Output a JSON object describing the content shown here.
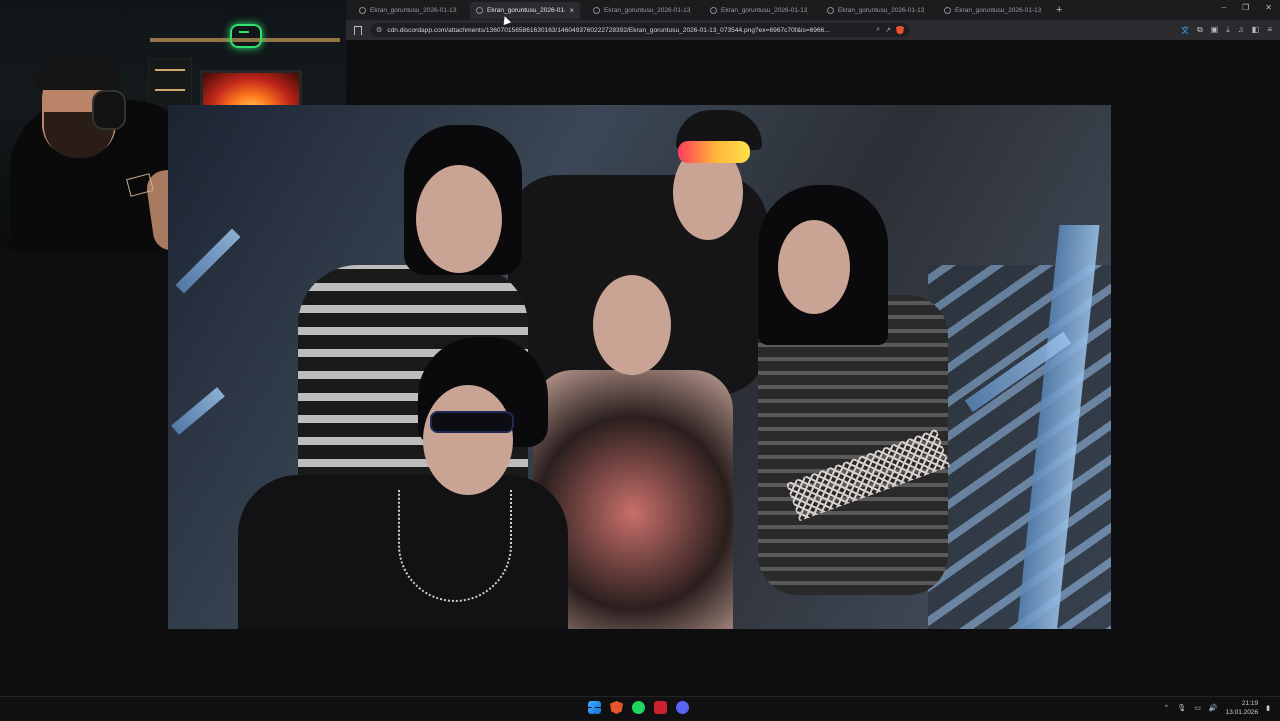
{
  "browser": {
    "tabs": [
      {
        "label": "Ekran_goruntusu_2026-01-13_072",
        "active": false
      },
      {
        "label": "Ekran_goruntusu_2026-01-13",
        "active": true
      },
      {
        "label": "Ekran_goruntusu_2026-01-13_073",
        "active": false
      },
      {
        "label": "Ekran_goruntusu_2026-01-13_073",
        "active": false
      },
      {
        "label": "Ekran_goruntusu_2026-01-13_072",
        "active": false
      },
      {
        "label": "Ekran_goruntusu_2026-01-13_073",
        "active": false
      }
    ],
    "new_tab": "+",
    "close_tab": "×",
    "window_controls": {
      "minimize": "–",
      "restore": "❐",
      "close": "✕"
    },
    "url": "cdn.discordapp.com/attachments/1360701565861630163/1460493760222728392/Ekran_goruntusu_2026-01-13_073544.png?ex=6967c70f&is=6966...",
    "accent_color": "#3fa7ff"
  },
  "main_image": {
    "kind": "group-photo",
    "description_icon": "image-icon"
  },
  "webcam": {
    "kind": "streamer-webcam-overlay"
  },
  "taskbar": {
    "apps": [
      "windows-start",
      "brave-browser",
      "spotify",
      "media-app",
      "discord"
    ],
    "clock_time": "21:19",
    "clock_date": "13.01.2026"
  }
}
